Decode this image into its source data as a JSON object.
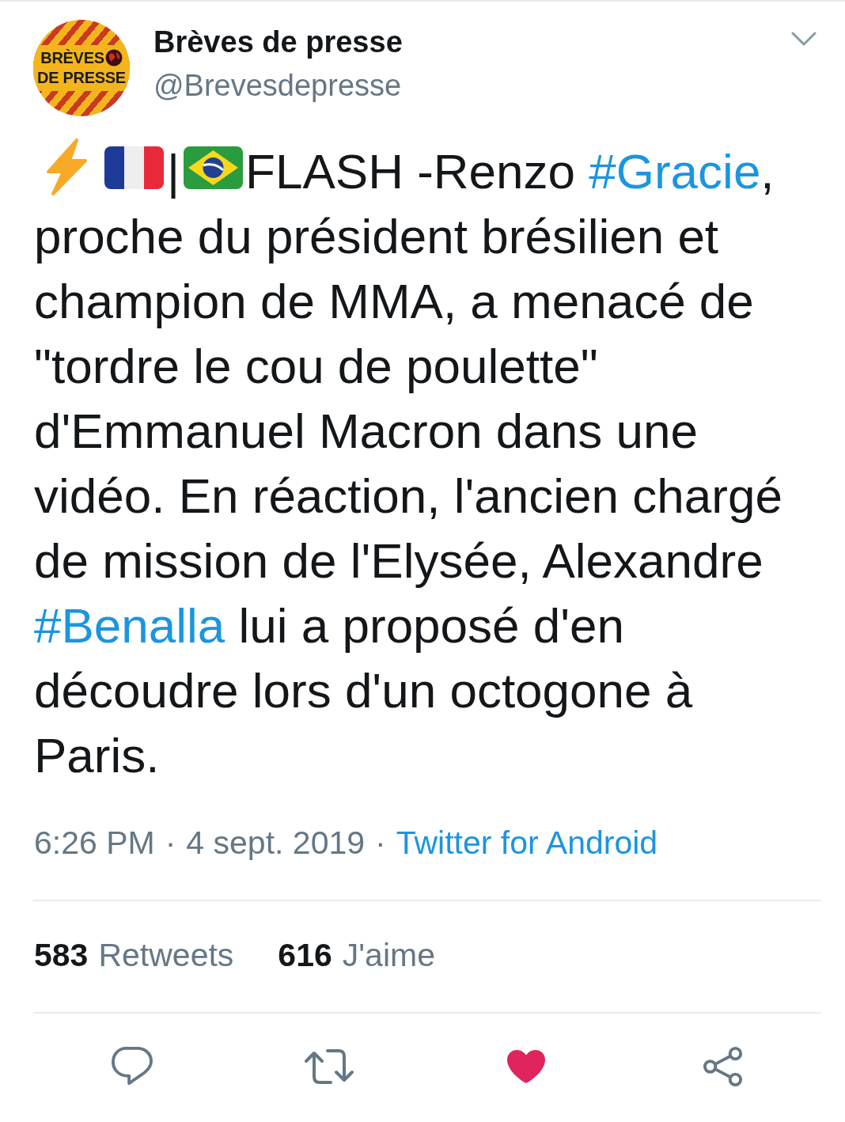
{
  "header": {
    "avatar": {
      "kind": "logo",
      "lines": [
        "BRÈVES",
        "DE PRESSE"
      ]
    },
    "name": "Brèves de presse",
    "handle": "@Brevesdepresse"
  },
  "body": [
    {
      "kind": "lightning"
    },
    {
      "kind": "flag_fr"
    },
    {
      "kind": "text",
      "text": "|"
    },
    {
      "kind": "flag_br"
    },
    {
      "kind": "text",
      "text": "FLASH -Renzo "
    },
    {
      "kind": "hashtag",
      "text": "#Gracie"
    },
    {
      "kind": "text",
      "text": ", proche du président brésilien et champion de MMA, a menacé de \"tordre le cou de poulette\" d'Emmanuel Macron dans une vidéo. En réaction, l'ancien chargé de mission de l'Elysée, Alexandre "
    },
    {
      "kind": "hashtag",
      "text": "#Benalla"
    },
    {
      "kind": "text",
      "text": " lui a proposé d'en découdre lors d'un octogone à Paris."
    }
  ],
  "meta": [
    {
      "kind": "time",
      "text": "6:26 PM"
    },
    {
      "kind": "separator",
      "text": "·"
    },
    {
      "kind": "date",
      "text": "4 sept. 2019"
    },
    {
      "kind": "separator",
      "text": "·"
    },
    {
      "kind": "source",
      "text": "Twitter for Android"
    }
  ],
  "stats": [
    {
      "count": "583",
      "label": "Retweets"
    },
    {
      "count": "616",
      "label": "J'aime"
    }
  ],
  "actions": [
    {
      "kind": "reply",
      "on": false
    },
    {
      "kind": "retweet",
      "on": false
    },
    {
      "kind": "like",
      "on": true
    },
    {
      "kind": "share",
      "on": false
    }
  ]
}
